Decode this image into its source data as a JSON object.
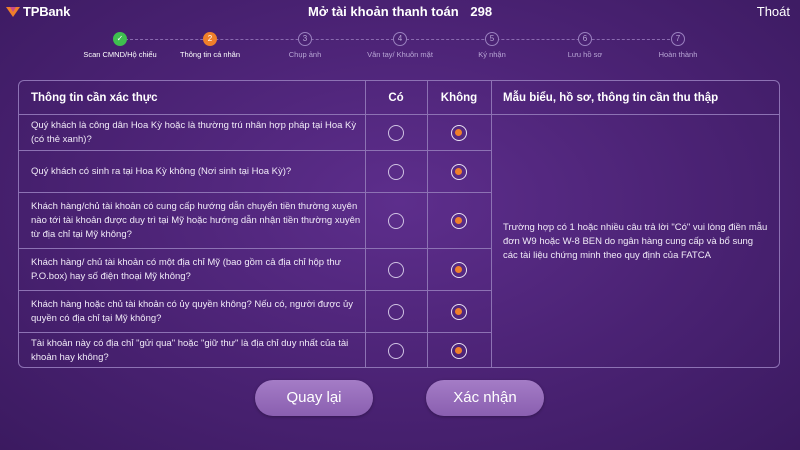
{
  "brand": {
    "logo_text": "TPBank",
    "accent": "#f07f2a",
    "success": "#3fbf4f",
    "background": "#4a2273"
  },
  "header": {
    "title": "Mở tài khoản thanh toán",
    "counter": "298",
    "exit_label": "Thoát"
  },
  "stepper": {
    "steps": [
      {
        "number": "✓",
        "label": "Scan CMND/Hộ chiếu",
        "state": "done"
      },
      {
        "number": "2",
        "label": "Thông tin cá nhân",
        "state": "active"
      },
      {
        "number": "3",
        "label": "Chụp ảnh",
        "state": "pending"
      },
      {
        "number": "4",
        "label": "Vân tay/ Khuôn mặt",
        "state": "pending"
      },
      {
        "number": "5",
        "label": "Ký nhận",
        "state": "pending"
      },
      {
        "number": "6",
        "label": "Lưu hồ sơ",
        "state": "pending"
      },
      {
        "number": "7",
        "label": "Hoàn thành",
        "state": "pending"
      }
    ]
  },
  "table": {
    "headers": {
      "question": "Thông tin cần xác thực",
      "yes": "Có",
      "no": "Không",
      "note": "Mẫu biểu, hồ sơ, thông tin cần thu thập"
    },
    "rows": [
      {
        "text": "Quý khách là công dân Hoa Kỳ hoặc là thường trú nhân hợp pháp tại Hoa Kỳ (có thẻ xanh)?",
        "answer": "no"
      },
      {
        "text": "Quý khách có sinh ra tại Hoa Kỳ không (Nơi sinh tại Hoa Kỳ)?",
        "answer": "no"
      },
      {
        "text": "Khách hàng/chủ tài khoản có cung cấp hướng dẫn chuyển tiền thường xuyên nào tới tài khoản được duy trì tại Mỹ hoặc hướng dẫn nhận tiền thường xuyên từ địa chỉ tại Mỹ không?",
        "answer": "no"
      },
      {
        "text": "Khách hàng/ chủ tài khoản có một địa chỉ Mỹ (bao gồm cả địa chỉ hộp thư P.O.box) hay số điện thoại Mỹ không?",
        "answer": "no"
      },
      {
        "text": "Khách hàng hoặc chủ tài khoản có ủy quyền không? Nếu có, người được ủy quyền có địa chỉ tại Mỹ không?",
        "answer": "no"
      },
      {
        "text": "Tài khoản này có địa chỉ \"gửi qua\" hoặc \"giữ thư\" là địa chỉ duy nhất của tài khoản hay không?",
        "answer": "no"
      }
    ],
    "note_text": "Trường hợp có 1 hoặc nhiều câu trả lời \"Có\" vui lòng điền mẫu đơn W9 hoặc W-8 BEN do ngân hàng cung cấp và bổ sung các tài liệu chứng minh theo quy định của FATCA"
  },
  "actions": {
    "back_label": "Quay lại",
    "confirm_label": "Xác nhận"
  }
}
